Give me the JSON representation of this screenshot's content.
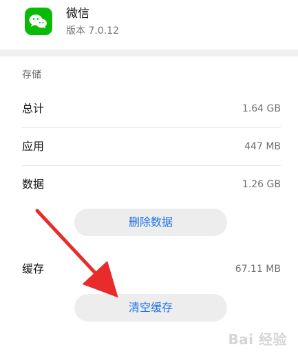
{
  "app": {
    "name": "微信",
    "version": "版本 7.0.12"
  },
  "storage": {
    "section_title": "存储",
    "rows": [
      {
        "label": "总计",
        "value": "1.64 GB"
      },
      {
        "label": "应用",
        "value": "447 MB"
      },
      {
        "label": "数据",
        "value": "1.26 GB"
      }
    ],
    "delete_data_label": "删除数据",
    "cache": {
      "label": "缓存",
      "value": "67.11 MB"
    },
    "clear_cache_label": "清空缓存"
  },
  "annotation": {
    "arrow_color": "#e82c2c"
  },
  "watermark": {
    "text": "Bai 经验"
  },
  "colors": {
    "brand": "#09bb07",
    "accent": "#1e73e8",
    "button_bg": "#ededed"
  },
  "icons": {
    "app_icon": "wechat-icon"
  }
}
